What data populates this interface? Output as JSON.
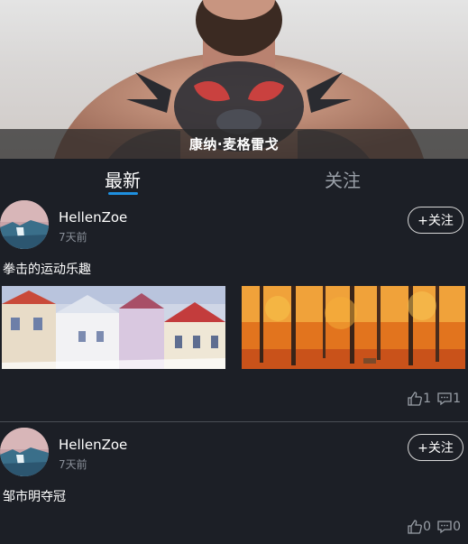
{
  "banner": {
    "caption": "康纳·麦格雷戈"
  },
  "tabs": [
    {
      "label": "最新",
      "active": true
    },
    {
      "label": "关注",
      "active": false
    }
  ],
  "posts": [
    {
      "username": "HellenZoe",
      "time": "7天前",
      "follow_label": "+关注",
      "title": "拳击的运动乐趣",
      "images": [
        "snowy-town-painting",
        "autumn-forest-painting"
      ],
      "likes": "1",
      "comments": "1"
    },
    {
      "username": "HellenZoe",
      "time": "7天前",
      "follow_label": "+关注",
      "title": "邹市明夺冠",
      "images": [],
      "likes": "0",
      "comments": "0"
    }
  ],
  "icons": {
    "like": "thumbs-up-icon",
    "comment": "comment-icon"
  },
  "colors": {
    "background": "#1c1f26",
    "accent": "#1e90e0",
    "muted": "#9aa0a8"
  }
}
